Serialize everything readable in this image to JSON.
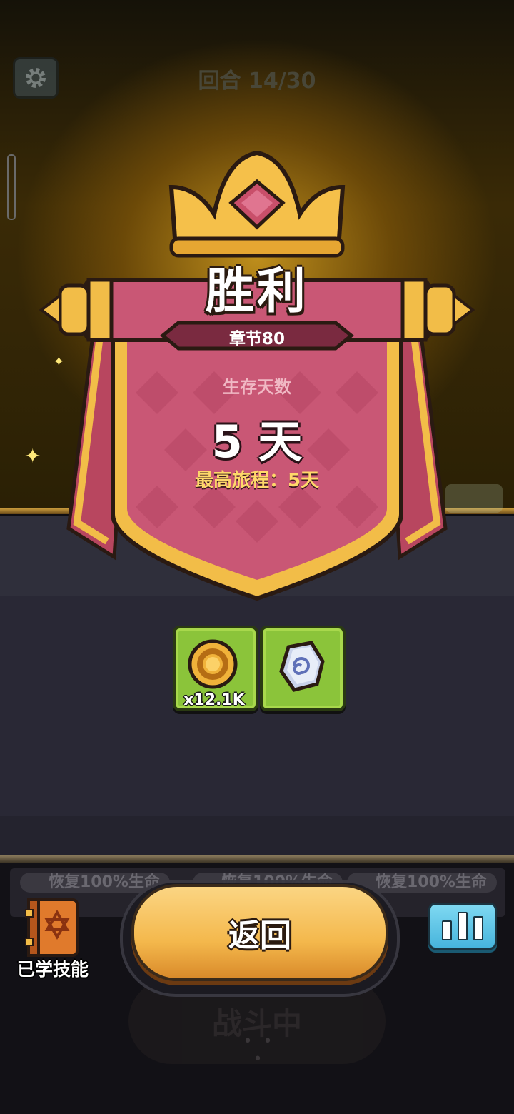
{
  "header": {
    "round_text": "回合 14/30"
  },
  "result": {
    "title": "胜利",
    "chapter": "章节80",
    "survival_label": "生存天数",
    "survival_days": "5 天",
    "best_journey": "最高旅程：5天"
  },
  "rewards": [
    {
      "icon": "gold-coin-icon",
      "count": "x12.1K"
    },
    {
      "icon": "rune-stone-icon",
      "count": ""
    }
  ],
  "background": {
    "buffs": [
      "恢复100%生命",
      "恢复100%生命",
      "恢复100%生命"
    ],
    "fighting_label": "战斗中",
    "fighting_dots": "• • •"
  },
  "controls": {
    "return_label": "返回",
    "learned_skills_label": "已学技能"
  },
  "colors": {
    "banner_red": "#c95775",
    "banner_gold": "#f2bd48",
    "reward_green": "#8bc43a",
    "return_button": "#f4b84c",
    "stats_button": "#5cc3e4"
  }
}
